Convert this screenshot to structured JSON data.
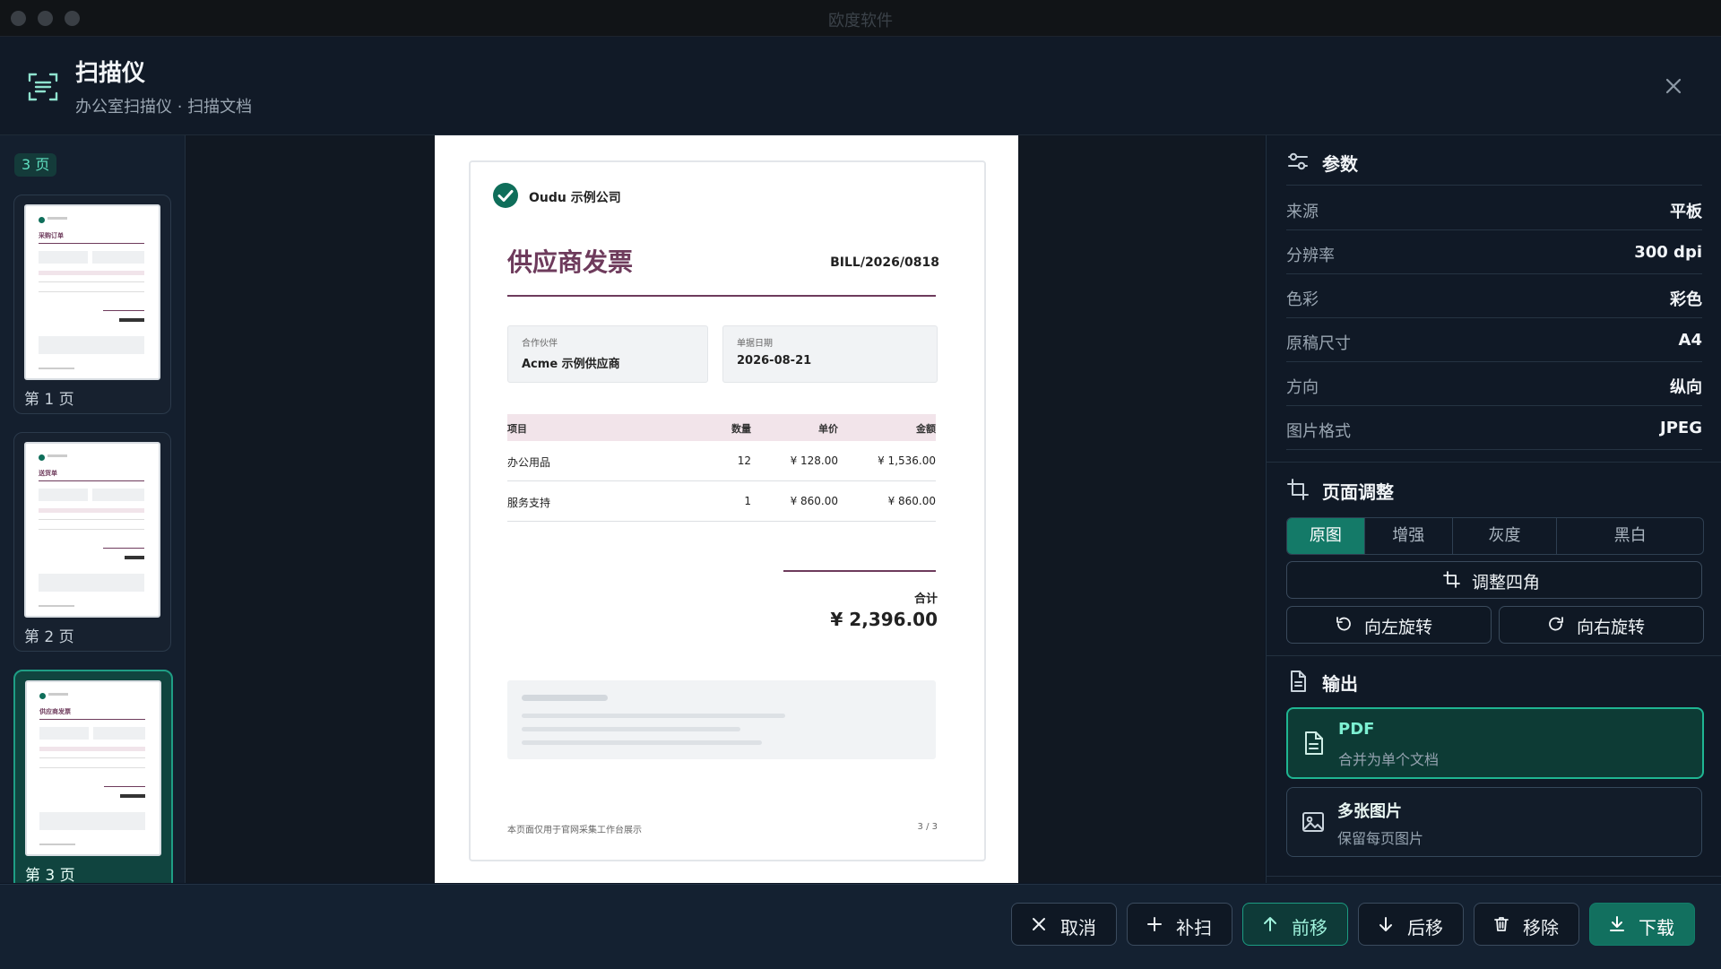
{
  "window": {
    "title": "欧度软件"
  },
  "header": {
    "title": "扫描仪",
    "subtitle": "办公室扫描仪 · 扫描文档"
  },
  "sidebar": {
    "page_count": "3 页",
    "pages": [
      {
        "label": "第 1 页",
        "doc_title": "采购订单"
      },
      {
        "label": "第 2 页",
        "doc_title": "送货单"
      },
      {
        "label": "第 3 页",
        "doc_title": "供应商发票"
      }
    ]
  },
  "document": {
    "company": "Oudu 示例公司",
    "title": "供应商发票",
    "doc_number": "BILL/2026/0818",
    "partner_label": "合作伙伴",
    "partner_value": "Acme 示例供应商",
    "date_label": "单据日期",
    "date_value": "2026-08-21",
    "table": {
      "headers": [
        "项目",
        "数量",
        "单价",
        "金额"
      ],
      "rows": [
        [
          "办公用品",
          "12",
          "¥ 128.00",
          "¥ 1,536.00"
        ],
        [
          "服务支持",
          "1",
          "¥ 860.00",
          "¥ 860.00"
        ]
      ]
    },
    "total_label": "合计",
    "total_value": "¥ 2,396.00",
    "footer_note": "本页面仅用于官网采集工作台展示",
    "page_indicator": "3 / 3"
  },
  "params": {
    "title": "参数",
    "rows": [
      {
        "key": "来源",
        "value": "平板"
      },
      {
        "key": "分辨率",
        "value": "300 dpi"
      },
      {
        "key": "色彩",
        "value": "彩色"
      },
      {
        "key": "原稿尺寸",
        "value": "A4"
      },
      {
        "key": "方向",
        "value": "纵向"
      },
      {
        "key": "图片格式",
        "value": "JPEG"
      }
    ]
  },
  "adjust": {
    "title": "页面调整",
    "modes": [
      "原图",
      "增强",
      "灰度",
      "黑白"
    ],
    "active_mode": "原图",
    "crop_label": "调整四角",
    "rotate_left_label": "向左旋转",
    "rotate_right_label": "向右旋转"
  },
  "output": {
    "title": "输出",
    "options": [
      {
        "title": "PDF",
        "desc": "合并为单个文档",
        "selected": true
      },
      {
        "title": "多张图片",
        "desc": "保留每页图片",
        "selected": false
      }
    ]
  },
  "footer": {
    "cancel": "取消",
    "rescan": "补扫",
    "move_up": "前移",
    "move_down": "后移",
    "remove": "移除",
    "download": "下载"
  },
  "colors": {
    "accent": "#147a68",
    "doc_title": "#6e3b5c",
    "background": "#0d1623"
  }
}
